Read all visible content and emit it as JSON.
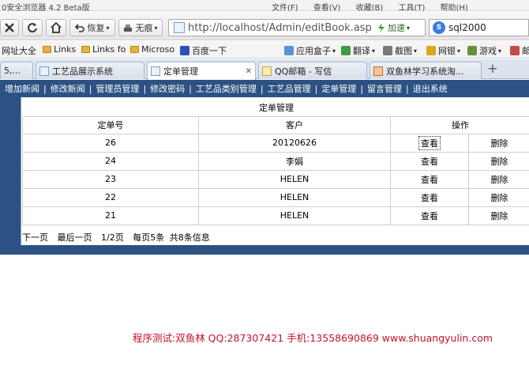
{
  "browser": {
    "app_title": "0安全浏览器 4.2 Beta版",
    "menu": [
      "文件(F)",
      "查看(V)",
      "收藏(B)",
      "工具(T)",
      "帮助(H)"
    ],
    "back_label": "恢复",
    "mode_label": "无痕",
    "url": "http://localhost/Admin/editBook.asp",
    "speed_label": "加速",
    "search_query": "sql2000"
  },
  "bookmarks": [
    {
      "label": "网址大全",
      "icon": "none"
    },
    {
      "label": "Links",
      "icon": "folder"
    },
    {
      "label": "Links fo",
      "icon": "folder"
    },
    {
      "label": "Microso",
      "icon": "folder"
    },
    {
      "label": "百度一下",
      "icon": "baidu-paw-icon"
    },
    {
      "label": "应用盒子",
      "icon": "app-box-icon"
    },
    {
      "label": "翻译",
      "icon": "translate-icon"
    },
    {
      "label": "截图",
      "icon": "screenshot-icon"
    },
    {
      "label": "网银",
      "icon": "bank-icon"
    },
    {
      "label": "游戏",
      "icon": "game-icon"
    },
    {
      "label": "邮",
      "icon": "mail-icon"
    }
  ],
  "tabs": [
    {
      "label": "5,...",
      "active": false
    },
    {
      "label": "工艺品展示系统",
      "active": false
    },
    {
      "label": "定单管理",
      "active": true
    },
    {
      "label": "QQ邮箱 - 写信",
      "active": false
    },
    {
      "label": "双鱼林学习系统淘...",
      "active": false
    }
  ],
  "site_nav": [
    "增加新闻",
    "修改新闻",
    "管理员管理",
    "修改密码",
    "工艺品类别管理",
    "工艺品管理",
    "定单管理",
    "留言管理",
    "退出系统"
  ],
  "orders": {
    "title": "定单管理",
    "headers": {
      "order_no": "定单号",
      "customer": "客户",
      "actions": "操作"
    },
    "view_label": "查看",
    "delete_label": "删除",
    "rows": [
      {
        "order_no": "26",
        "customer": "20120626"
      },
      {
        "order_no": "24",
        "customer": "李娟"
      },
      {
        "order_no": "23",
        "customer": "HELEN"
      },
      {
        "order_no": "22",
        "customer": "HELEN"
      },
      {
        "order_no": "21",
        "customer": "HELEN"
      }
    ]
  },
  "pager": {
    "next": "下一页",
    "last": "最后一页",
    "page_info": "1/2页",
    "per_page": "每页5条",
    "total": "共8条信息"
  },
  "footer": "程序测试:双鱼林 QQ:287307421 手机:13558690869 www.shuangyulin.com"
}
